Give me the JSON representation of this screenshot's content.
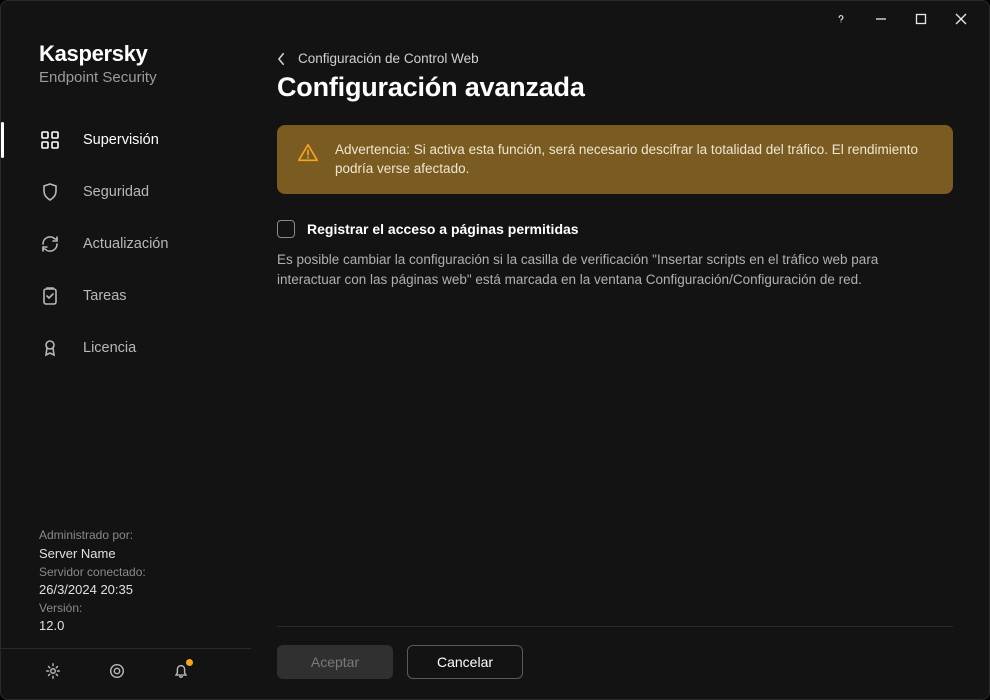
{
  "app": {
    "brand": "Kaspersky",
    "product": "Endpoint Security"
  },
  "sidebar": {
    "items": [
      {
        "label": "Supervisión",
        "active": true
      },
      {
        "label": "Seguridad",
        "active": false
      },
      {
        "label": "Actualización",
        "active": false
      },
      {
        "label": "Tareas",
        "active": false
      },
      {
        "label": "Licencia",
        "active": false
      }
    ],
    "info": {
      "managed_by_label": "Administrado por:",
      "managed_by_value": "Server Name",
      "connected_label": "Servidor conectado:",
      "connected_value": "26/3/2024 20:35",
      "version_label": "Versión:",
      "version_value": "12.0"
    }
  },
  "breadcrumb": {
    "parent": "Configuración de Control Web"
  },
  "page": {
    "title": "Configuración avanzada",
    "warning": "Advertencia: Si activa esta función, será necesario descifrar la totalidad del tráfico. El rendimiento podría verse afectado.",
    "checkbox_label": "Registrar el acceso a páginas permitidas",
    "help_text": "Es posible cambiar la configuración si la casilla de verificación \"Insertar scripts en el tráfico web para interactuar con las páginas web\" está marcada en la ventana Configuración/Configuración de red."
  },
  "buttons": {
    "accept": "Aceptar",
    "cancel": "Cancelar"
  }
}
